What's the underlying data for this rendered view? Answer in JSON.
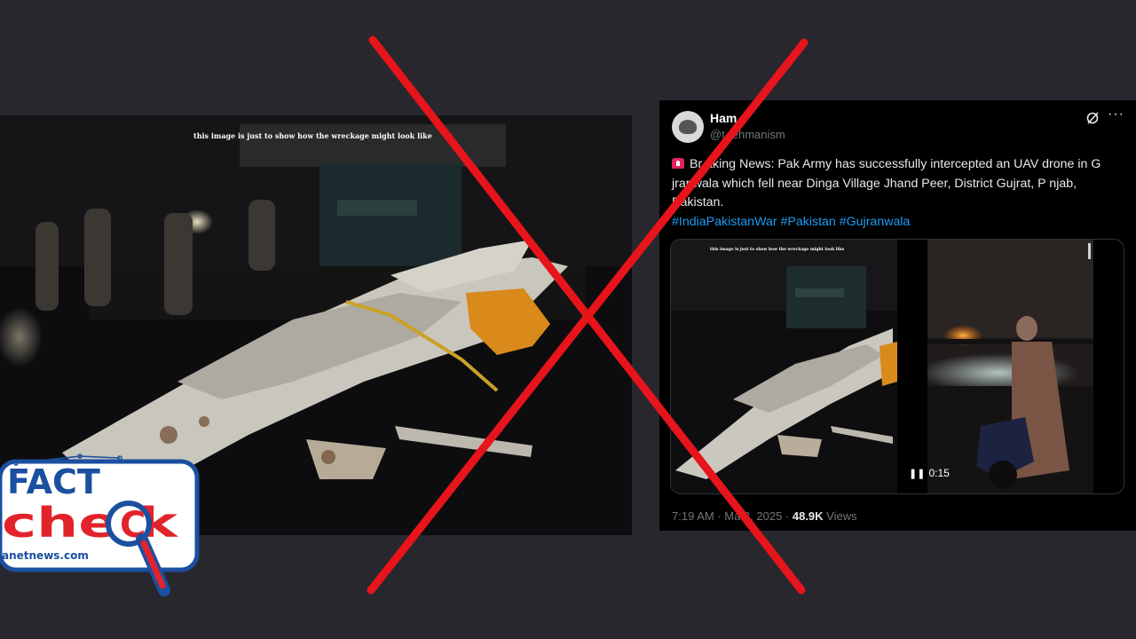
{
  "left_image": {
    "caption": "this image is just to show how the wreckage might look like"
  },
  "tweet": {
    "name": "Ham",
    "handle": "@t rehmanism",
    "text": "Br  aking News: Pak Army has successfully intercepted an UAV drone in G jranwala which fell near Dinga Village Jhand Peer, District Gujrat, P njab, Pakistan.",
    "hashtags": "#IndiaPakistanWar #Pakistan #Gujranwala",
    "media_caption": "this image is just to show how the wreckage might look like",
    "video_time": "0:15",
    "timestamp": "7:19 AM · Ma  8, 2025 · ",
    "views_count": "48.9K",
    "views_label": " Views",
    "more": "···"
  },
  "logo": {
    "line1": "FACT",
    "line2": "che  k",
    "site": "anetnews.com"
  },
  "colors": {
    "background": "#29272e",
    "cross": "#e8141b",
    "hashtag": "#1d9bf0",
    "logo_blue": "#1b4fa0",
    "logo_red": "#e2232b"
  }
}
